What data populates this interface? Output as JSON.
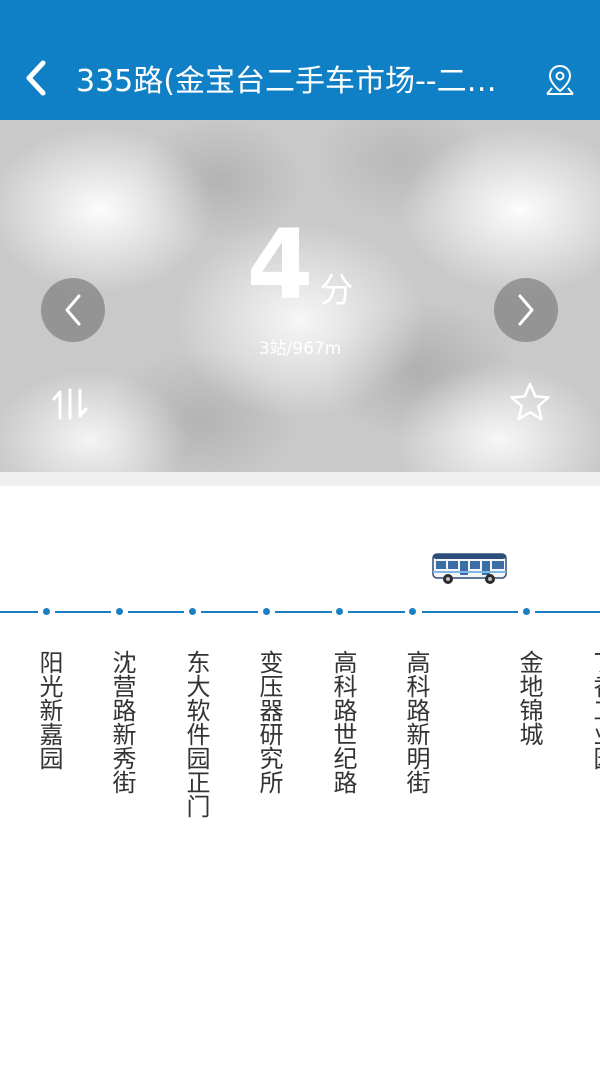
{
  "header": {
    "title": "335路(金宝台二手车市场--二…",
    "back_icon": "chevron-left-icon",
    "location_icon": "map-pin-icon"
  },
  "arrival": {
    "minutes": "4",
    "unit": "分",
    "distance": "3站/967m"
  },
  "controls": {
    "prev_icon": "chevron-left-icon",
    "next_icon": "chevron-right-icon",
    "swap_icon": "swap-direction-icon",
    "favorite_icon": "star-outline-icon"
  },
  "colors": {
    "header_bg": "#0f7fc6",
    "route_line": "#1a7fc2",
    "stop_text": "#333333"
  },
  "route": {
    "stops": [
      "阳光新嘉园",
      "沈营路新秀街",
      "东大软件园正门",
      "变压器研究所",
      "高科路世纪路",
      "高科路新明街",
      "金地锦城",
      "丁香工业园"
    ],
    "bus_position_stop_index": 5
  }
}
